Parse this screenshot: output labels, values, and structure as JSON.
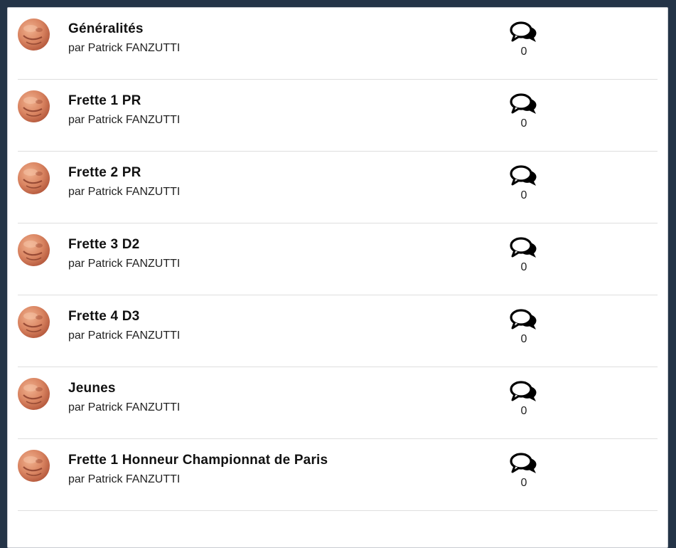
{
  "topics": [
    {
      "title": "Généralités",
      "author_line": "par Patrick FANZUTTI",
      "reply_count": "0"
    },
    {
      "title": "Frette 1 PR",
      "author_line": "par Patrick FANZUTTI",
      "reply_count": "0"
    },
    {
      "title": "Frette 2 PR",
      "author_line": "par Patrick FANZUTTI",
      "reply_count": "0"
    },
    {
      "title": "Frette 3 D2",
      "author_line": "par Patrick FANZUTTI",
      "reply_count": "0"
    },
    {
      "title": "Frette 4 D3",
      "author_line": "par Patrick FANZUTTI",
      "reply_count": "0"
    },
    {
      "title": "Jeunes",
      "author_line": "par Patrick FANZUTTI",
      "reply_count": "0"
    },
    {
      "title": "Frette 1 Honneur Championnat de Paris",
      "author_line": "par Patrick FANZUTTI",
      "reply_count": "0"
    }
  ],
  "icons": {
    "avatar": "user-avatar-photo",
    "comments": "comments-icon"
  },
  "colors": {
    "page_background": "#243447",
    "panel_background": "#ffffff",
    "divider": "#dedede"
  }
}
